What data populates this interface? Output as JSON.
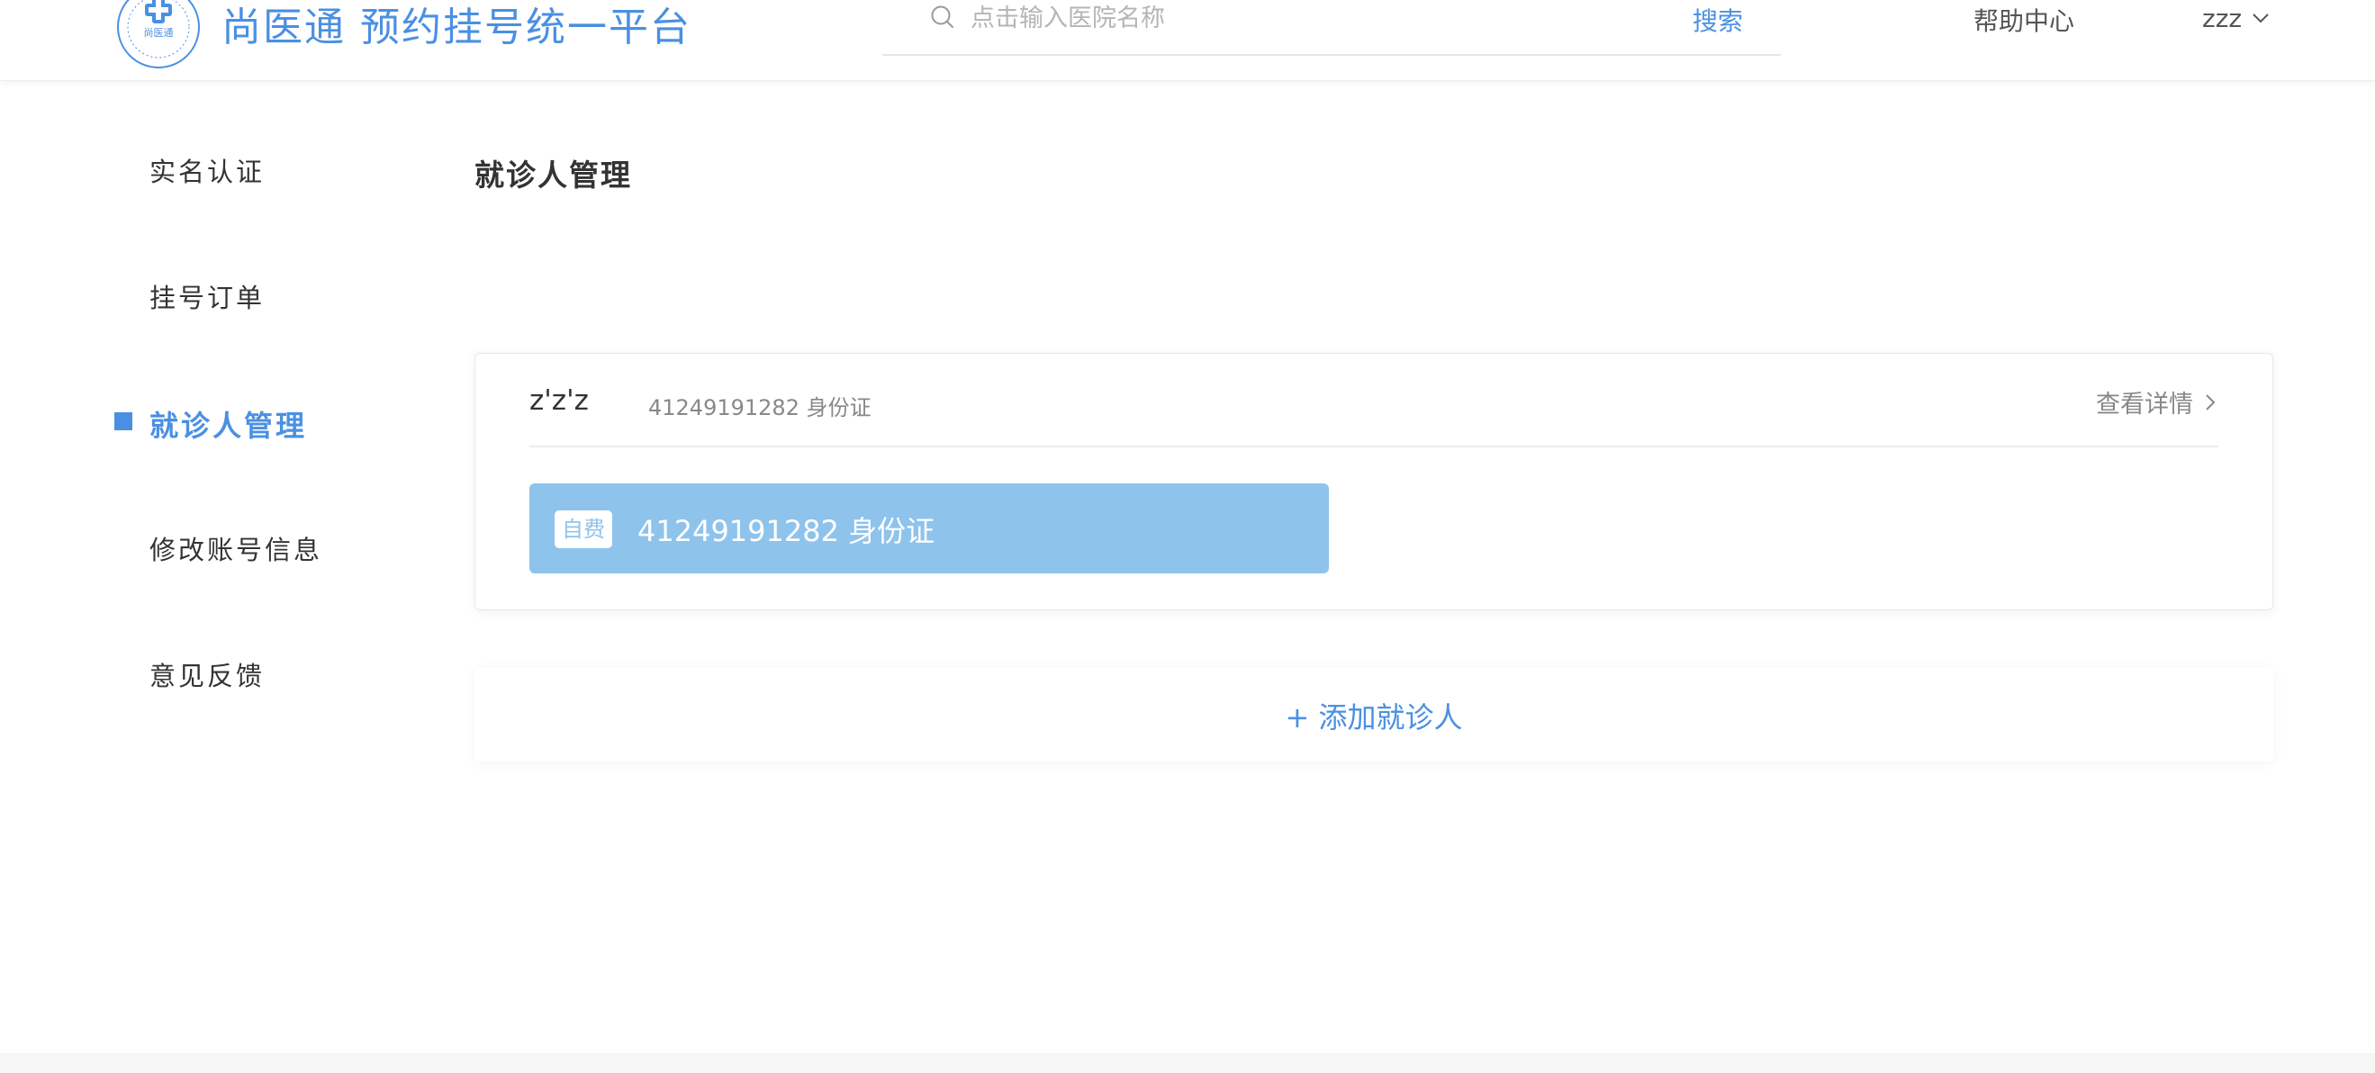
{
  "header": {
    "logo_text": "尚医通",
    "title": "尚医通 预约挂号统一平台",
    "search": {
      "placeholder": "点击输入医院名称",
      "button_label": "搜索"
    },
    "help_label": "帮助中心",
    "user_name": "zzz"
  },
  "sidebar": {
    "items": [
      {
        "label": "实名认证",
        "active": false
      },
      {
        "label": "挂号订单",
        "active": false
      },
      {
        "label": "就诊人管理",
        "active": true
      },
      {
        "label": "修改账号信息",
        "active": false
      },
      {
        "label": "意见反馈",
        "active": false
      }
    ]
  },
  "main": {
    "page_title": "就诊人管理",
    "patients": [
      {
        "name": "z'z'z",
        "id_line": "41249191282 身份证",
        "detail_label": "查看详情",
        "badge": "自费",
        "bar_text": "41249191282   身份证"
      }
    ],
    "add_label": "+ 添加就诊人"
  },
  "colors": {
    "accent": "#4a90e2",
    "insurance_bar": "#8ec3ec"
  },
  "icons": [
    "logo-icon",
    "search-icon",
    "chevron-down-icon",
    "chevron-right-icon"
  ]
}
